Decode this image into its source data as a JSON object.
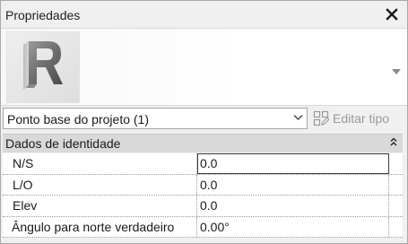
{
  "panel": {
    "title": "Propriedades",
    "close_icon": "close-icon"
  },
  "type_selector": {
    "thumbnail_icon": "revit-r-logo",
    "scroll_icon": "chevron-down-icon"
  },
  "toolbar": {
    "instance_label": "Ponto base do projeto (1)",
    "edit_type_label": "Editar tipo",
    "edit_type_icon": "edit-type-icon"
  },
  "group": {
    "label": "Dados de identidade",
    "collapse_icon": "collapse-icon"
  },
  "properties": [
    {
      "name": "N/S",
      "value": "0.0"
    },
    {
      "name": "L/O",
      "value": "0.0"
    },
    {
      "name": "Elev",
      "value": "0.0"
    },
    {
      "name": "Ângulo para norte verdadeiro",
      "value": "0.00°"
    }
  ],
  "colors": {
    "panel_bg": "#f0f0f0",
    "group_bg": "#d9d9d9",
    "disabled_text": "#9a9a9a"
  }
}
